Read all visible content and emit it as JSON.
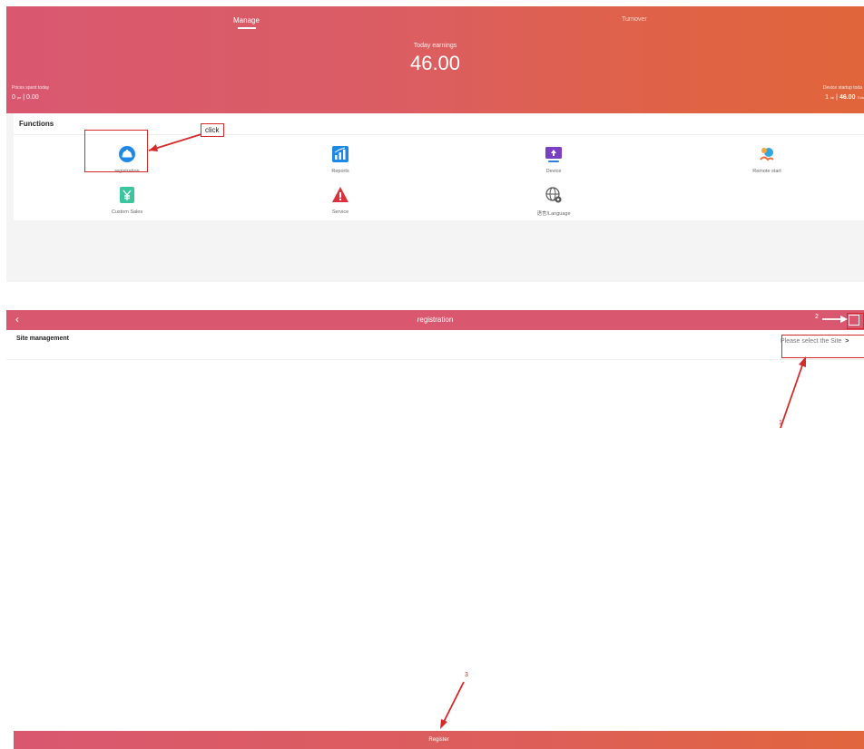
{
  "manage_screen": {
    "tabs": {
      "manage": "Manage",
      "turnover": "Turnover"
    },
    "earnings": {
      "label": "Today earnings",
      "value": "46.00"
    },
    "left_stat": {
      "label": "Prices spent today",
      "count": "0",
      "unit": "pe",
      "sep": "|",
      "amount": "0.00"
    },
    "right_stat": {
      "label": "Device startup toda",
      "count": "1",
      "unit": "tai",
      "sep": "|",
      "amount": "46.00",
      "suffix": "Tota"
    },
    "functions": {
      "title": "Functions",
      "items": [
        {
          "label": "registration",
          "icon": "registration-icon",
          "color": "#1e88e5"
        },
        {
          "label": "Reports",
          "icon": "reports-icon",
          "color": "#1e88e5"
        },
        {
          "label": "Device",
          "icon": "device-icon",
          "color": "#7b3fc4"
        },
        {
          "label": "Remote start",
          "icon": "remote-start-icon",
          "color": "#2ea8e0"
        },
        {
          "label": "Custom Sales",
          "icon": "custom-sales-icon",
          "color": "#3bc6a0"
        },
        {
          "label": "Service",
          "icon": "service-icon",
          "color": "#d9333f"
        },
        {
          "label": "语言/Language",
          "icon": "language-icon",
          "color": "#555555"
        }
      ]
    },
    "annotation_click": "click"
  },
  "registration_screen": {
    "title": "registration",
    "back_icon": "chevron-left-icon",
    "site_label": "Site management",
    "site_placeholder": "Please select the Site",
    "register_label": "Register",
    "annotations": {
      "n1": "1",
      "n2": "2",
      "n3": "3"
    }
  },
  "colors": {
    "gradient_start": "#d95870",
    "gradient_end": "#e1653a",
    "annotation_red": "#d42a2a"
  }
}
